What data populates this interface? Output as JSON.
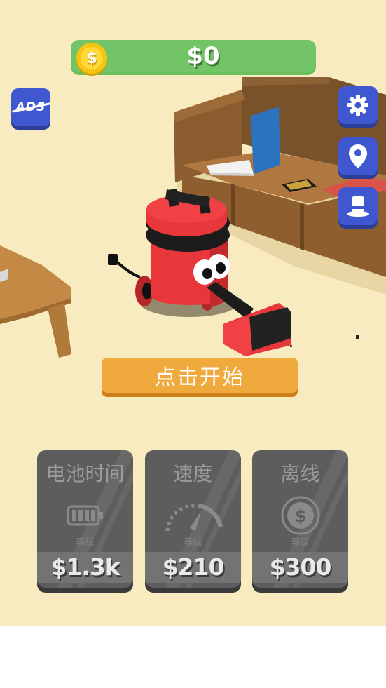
{
  "hud": {
    "money": "$0",
    "coin_symbol": "$",
    "ads_label": "ADS"
  },
  "side_buttons": [
    {
      "icon": "gear-icon"
    },
    {
      "icon": "map-pin-icon"
    },
    {
      "icon": "top-hat-icon"
    }
  ],
  "start_button": {
    "label": "点击开始"
  },
  "upgrades": [
    {
      "title": "电池时间",
      "level": "等级",
      "price": "$1.3k",
      "icon": "battery-icon"
    },
    {
      "title": "速度",
      "level": "等级",
      "price": "$210",
      "icon": "speedometer-icon"
    },
    {
      "title": "离线",
      "level": "等级",
      "price": "$300",
      "icon": "dollar-coin-icon"
    }
  ],
  "colors": {
    "background": "#f8ebbf",
    "money_bar": "#72c466",
    "blue_button": "#3f58d0",
    "start_button": "#f0a93d",
    "card_disabled": "#5d5d5d",
    "vacuum_red": "#e8373a"
  }
}
